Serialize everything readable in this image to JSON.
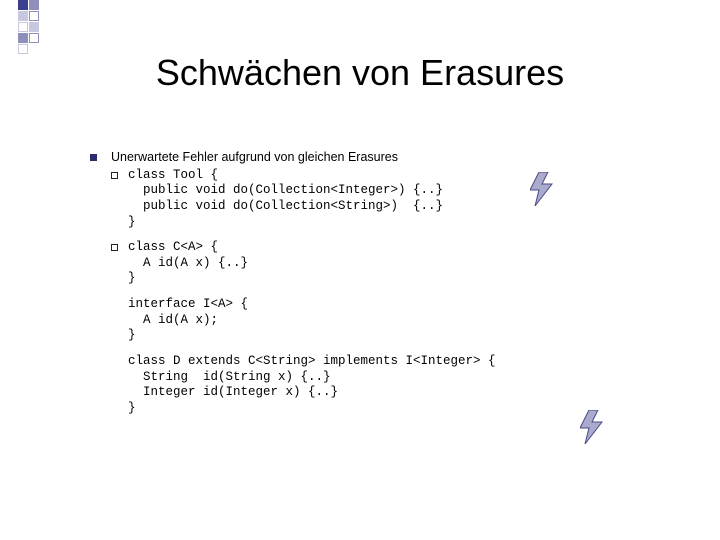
{
  "title": "Schwächen von Erasures",
  "bullet": {
    "text": "Unerwartete Fehler aufgrund von gleichen Erasures"
  },
  "code1": {
    "l1": "class Tool {",
    "l2": "  public void do(Collection<Integer>) {..}",
    "l3": "  public void do(Collection<String>)  {..}",
    "l4": "}"
  },
  "code2": {
    "l1": "class C<A> {",
    "l2": "  A id(A x) {..}",
    "l3": "}"
  },
  "code3": {
    "l1": "interface I<A> {",
    "l2": "  A id(A x);",
    "l3": "}"
  },
  "code4": {
    "l1": "class D extends C<String> implements I<Integer> {",
    "l2": "  String  id(String x) {..}",
    "l3": "  Integer id(Integer x) {..}",
    "l4": "}"
  },
  "deco": {
    "c1": "#3a3f8e",
    "c2": "#8e90bb",
    "c3": "#c7c8e0",
    "c4": "#ffffff"
  }
}
